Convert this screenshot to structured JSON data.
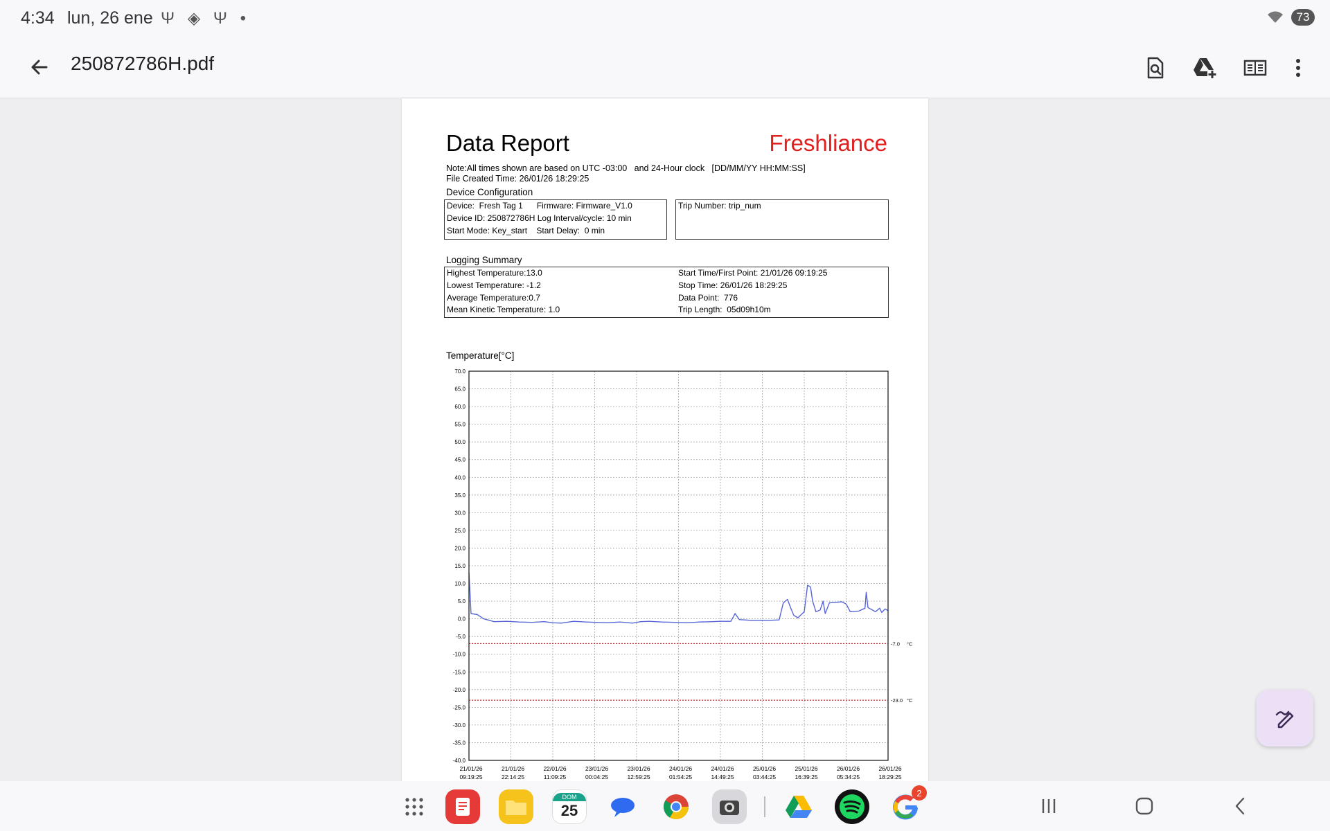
{
  "status_bar": {
    "time": "4:34",
    "date": "lun, 26 ene",
    "notification_icons": "Ψ ◈ Ψ •",
    "battery_level": "73"
  },
  "app_bar": {
    "title": "250872786H.pdf",
    "icons": [
      "back-arrow-icon",
      "search-document-icon",
      "add-to-drive-icon",
      "reading-mode-icon",
      "more-vert-icon"
    ]
  },
  "report": {
    "title": "Data Report",
    "brand": "Freshliance",
    "note_line1": "Note:All times shown are based on UTC -03:00   and 24-Hour clock   [DD/MM/YY HH:MM:SS]",
    "note_line2": "File Created Time: 26/01/26 18:29:25",
    "device_config_heading": "Device Configuration",
    "device_lines": [
      "Device:  Fresh Tag 1      Firmware: Firmware_V1.0",
      "Device ID: 250872786H Log Interval/cycle: 10 min",
      "Start Mode: Key_start    Start Delay:  0 min"
    ],
    "trip_number": "Trip Number: trip_num",
    "logging_summary_heading": "Logging Summary",
    "summary_left": [
      "Highest Temperature:13.0",
      "Lowest Temperature: -1.2",
      "Average Temperature:0.7",
      "Mean Kinetic Temperature: 1.0"
    ],
    "summary_right": [
      "Start Time/First Point: 21/01/26 09:19:25",
      "Stop Time: 26/01/26 18:29:25",
      "Data Point:  776",
      "Trip Length:  05d09h10m"
    ]
  },
  "chart_data": {
    "type": "line",
    "title": "",
    "ylabel": "Temperature[°C]",
    "xlabel": "",
    "ylim": [
      -40,
      70
    ],
    "y_ticks": [
      "70.0",
      "65.0",
      "60.0",
      "55.0",
      "50.0",
      "45.0",
      "40.0",
      "35.0",
      "30.0",
      "25.0",
      "20.0",
      "15.0",
      "10.0",
      "5.0",
      "0.0",
      "-5.0",
      "-10.0",
      "-15.0",
      "-20.0",
      "-25.0",
      "-30.0",
      "-35.0",
      "-40.0"
    ],
    "x_ticks": [
      [
        "21/01/26",
        "09:19:25"
      ],
      [
        "21/01/26",
        "22:14:25"
      ],
      [
        "22/01/26",
        "11:09:25"
      ],
      [
        "23/01/26",
        "00:04:25"
      ],
      [
        "23/01/26",
        "12:59:25"
      ],
      [
        "24/01/26",
        "01:54:25"
      ],
      [
        "24/01/26",
        "14:49:25"
      ],
      [
        "25/01/26",
        "03:44:25"
      ],
      [
        "25/01/26",
        "16:39:25"
      ],
      [
        "26/01/26",
        "05:34:25"
      ],
      [
        "26/01/26",
        "18:29:25"
      ]
    ],
    "grid": true,
    "thresholds": [
      {
        "value": -7.0,
        "label": "-7.0",
        "unit": "°C",
        "color": "#e0201e"
      },
      {
        "value": -23.0,
        "label": "-23.0",
        "unit": "°C",
        "color": "#e0201e"
      }
    ],
    "series": [
      {
        "color": "#5565d8",
        "points": [
          [
            0.0,
            13.0
          ],
          [
            0.05,
            1.5
          ],
          [
            0.2,
            1.2
          ],
          [
            0.35,
            0.0
          ],
          [
            0.6,
            -0.8
          ],
          [
            0.9,
            -0.7
          ],
          [
            1.2,
            -0.9
          ],
          [
            1.5,
            -1.0
          ],
          [
            1.8,
            -0.8
          ],
          [
            2.0,
            -1.1
          ],
          [
            2.2,
            -1.2
          ],
          [
            2.5,
            -0.7
          ],
          [
            2.8,
            -0.9
          ],
          [
            3.0,
            -1.0
          ],
          [
            3.3,
            -1.1
          ],
          [
            3.6,
            -0.9
          ],
          [
            3.9,
            -1.2
          ],
          [
            4.1,
            -0.8
          ],
          [
            4.3,
            -0.7
          ],
          [
            4.6,
            -0.9
          ],
          [
            4.9,
            -1.0
          ],
          [
            5.2,
            -1.1
          ],
          [
            5.5,
            -0.9
          ],
          [
            5.8,
            -0.8
          ],
          [
            6.0,
            -0.7
          ],
          [
            6.25,
            -0.7
          ],
          [
            6.35,
            1.5
          ],
          [
            6.45,
            -0.2
          ],
          [
            6.7,
            -0.4
          ],
          [
            7.0,
            -0.4
          ],
          [
            7.2,
            -0.4
          ],
          [
            7.4,
            -0.3
          ],
          [
            7.5,
            4.5
          ],
          [
            7.6,
            5.5
          ],
          [
            7.68,
            3.0
          ],
          [
            7.75,
            1.0
          ],
          [
            7.85,
            0.3
          ],
          [
            8.0,
            2.0
          ],
          [
            8.08,
            9.5
          ],
          [
            8.15,
            9.0
          ],
          [
            8.2,
            5.0
          ],
          [
            8.28,
            2.0
          ],
          [
            8.38,
            2.5
          ],
          [
            8.45,
            5.0
          ],
          [
            8.5,
            1.5
          ],
          [
            8.6,
            4.5
          ],
          [
            8.9,
            4.8
          ],
          [
            9.0,
            4.2
          ],
          [
            9.1,
            2.0
          ],
          [
            9.3,
            2.2
          ],
          [
            9.45,
            3.0
          ],
          [
            9.48,
            7.5
          ],
          [
            9.52,
            3.2
          ],
          [
            9.7,
            2.0
          ],
          [
            9.8,
            3.0
          ],
          [
            9.85,
            1.8
          ],
          [
            9.93,
            2.8
          ],
          [
            10.0,
            2.3
          ]
        ]
      }
    ]
  },
  "fab": {
    "icon": "edit-pen-icon"
  },
  "dock": {
    "apps": [
      "all-apps-icon",
      "notes-app-icon",
      "files-app-icon",
      "calendar-app-icon",
      "messages-app-icon",
      "chrome-app-icon",
      "camera-app-icon",
      "drive-app-icon",
      "spotify-app-icon",
      "google-app-icon"
    ],
    "calendar_day_label": "DOM",
    "calendar_day_number": "25",
    "google_badge_count": "2"
  },
  "nav_buttons": [
    "recents-button",
    "home-button",
    "back-button"
  ]
}
